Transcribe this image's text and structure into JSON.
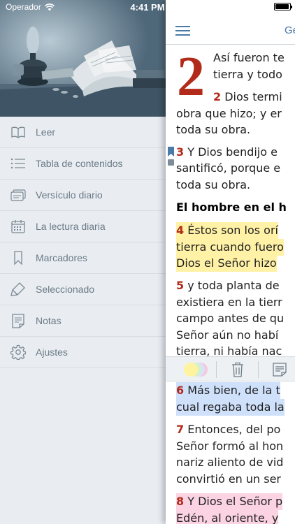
{
  "status_bar": {
    "carrier": "Operador",
    "time": "4:41 PM"
  },
  "sidebar": {
    "items": [
      {
        "label": "Leer",
        "icon": "book-open-icon"
      },
      {
        "label": "Tabla de contenidos",
        "icon": "list-icon"
      },
      {
        "label": "Versículo diario",
        "icon": "cards-icon"
      },
      {
        "label": "La lectura diaria",
        "icon": "calendar-icon"
      },
      {
        "label": "Marcadores",
        "icon": "bookmark-icon"
      },
      {
        "label": "Seleccionado",
        "icon": "highlighter-icon"
      },
      {
        "label": "Notas",
        "icon": "note-icon"
      },
      {
        "label": "Ajustes",
        "icon": "gear-icon"
      }
    ]
  },
  "reader": {
    "title": "Gé",
    "chapter_number": "2",
    "lines": [
      {
        "text": "Así fueron te"
      },
      {
        "text": "tierra y todo"
      },
      {
        "num": "2",
        "text": " Dios termi"
      },
      {
        "text": "obra que hizo; y er"
      },
      {
        "text": "toda su obra."
      },
      {
        "num": "3",
        "text": " Y Dios bendijo e"
      },
      {
        "text": "santificó, porque e"
      },
      {
        "text": "toda su obra."
      },
      {
        "heading": "El hombre en el h"
      },
      {
        "num": "4",
        "text": " Éstos son los orí"
      },
      {
        "text": "tierra cuando fuero"
      },
      {
        "text": "Dios el Señor hizo"
      },
      {
        "num": "5",
        "text": " y toda planta de"
      },
      {
        "text": "existiera en la tierr"
      },
      {
        "text": "campo antes de qu"
      },
      {
        "text": "Señor aún no habí"
      },
      {
        "text": "tierra, ni había nac"
      },
      {
        "num": "6",
        "text": " Más bien, de la t"
      },
      {
        "text": "cual regaba toda la"
      },
      {
        "num": "7",
        "text": " Entonces, del po"
      },
      {
        "text": "Señor formó al hon"
      },
      {
        "text": "nariz aliento de vid"
      },
      {
        "text": "convirtió en un ser"
      },
      {
        "num": "8",
        "text": " Y Dios el Señor p"
      },
      {
        "text": "Edén, al oriente, y"
      }
    ]
  },
  "colors": {
    "accent": "#4a7aa8",
    "verse_number": "#b22a1a",
    "highlight_yellow": "#fff2a6",
    "highlight_blue": "#cfe0fb",
    "highlight_pink": "#fbd3e2"
  }
}
